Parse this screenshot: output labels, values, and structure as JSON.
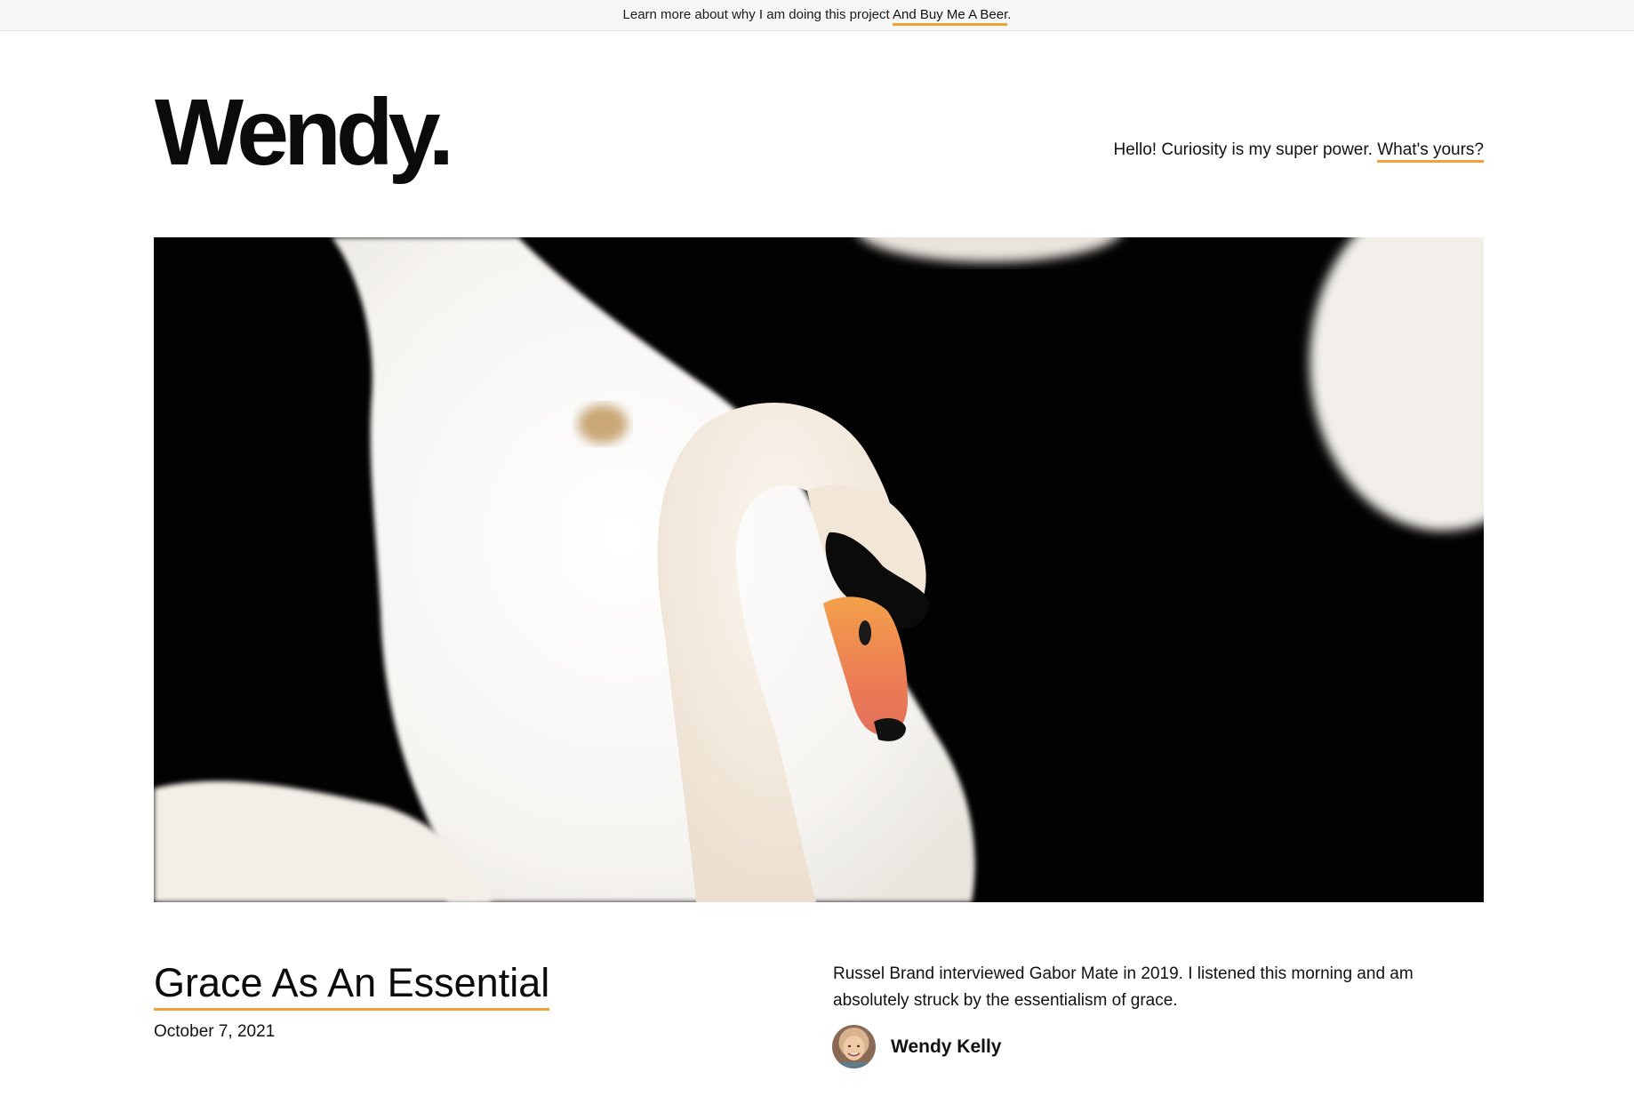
{
  "colors": {
    "accent": "#f0a23a",
    "text": "#111111",
    "topbar_bg": "#f7f7f7",
    "hero_bg": "#000000"
  },
  "topbar": {
    "text": "Learn more about why I am doing this project ",
    "link_label": "And Buy Me A Beer",
    "suffix": "."
  },
  "header": {
    "logo": "Wendy.",
    "tagline_text": "Hello! Curiosity is my super power. ",
    "tagline_link": "What's yours?"
  },
  "hero": {
    "subject": "white swan on dark water"
  },
  "post": {
    "title": "Grace As An Essential",
    "date": "October 7, 2021",
    "excerpt": "Russel Brand interviewed Gabor Mate in 2019. I listened this morning and am absolutely struck by the essentialism of grace.",
    "author": {
      "name": "Wendy Kelly",
      "avatar_icon": "author-avatar"
    }
  }
}
